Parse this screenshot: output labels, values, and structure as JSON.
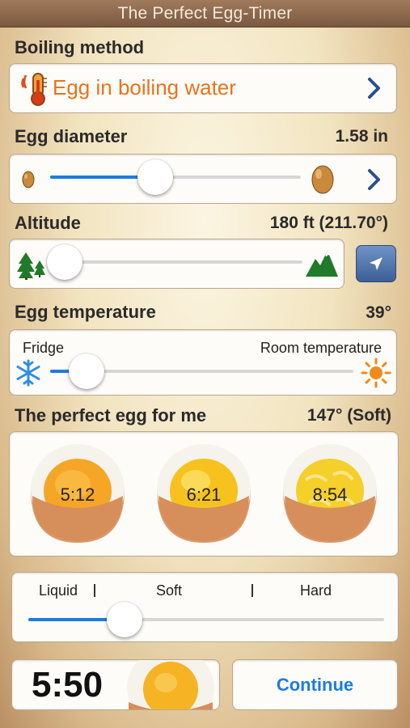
{
  "app": {
    "title": "The Perfect Egg-Timer"
  },
  "boiling_method": {
    "label": "Boiling method",
    "value": "Egg in boiling water",
    "icon": "thermometer-icon",
    "value_color": "#e8731c"
  },
  "egg_diameter": {
    "label": "Egg diameter",
    "value": "1.58 in",
    "slider_fraction": 0.42
  },
  "altitude": {
    "label": "Altitude",
    "value": "180 ft (211.70°)",
    "slider_fraction": 0.05
  },
  "egg_temperature": {
    "label": "Egg temperature",
    "value": "39°",
    "min_label": "Fridge",
    "max_label": "Room temperature",
    "slider_fraction": 0.12
  },
  "perfect_egg": {
    "label": "The perfect egg for me",
    "value": "147° (Soft)",
    "eggs": [
      {
        "time": "5:12",
        "doneness": "soft"
      },
      {
        "time": "6:21",
        "doneness": "medium"
      },
      {
        "time": "8:54",
        "doneness": "hard"
      }
    ]
  },
  "consistency": {
    "labels": [
      "Liquid",
      "Soft",
      "Hard"
    ],
    "slider_fraction": 0.27
  },
  "timer": {
    "value": "5:50"
  },
  "continue_button": {
    "label": "Continue"
  },
  "colors": {
    "accent": "#1d7be0",
    "chevron": "#2d4f8f"
  }
}
